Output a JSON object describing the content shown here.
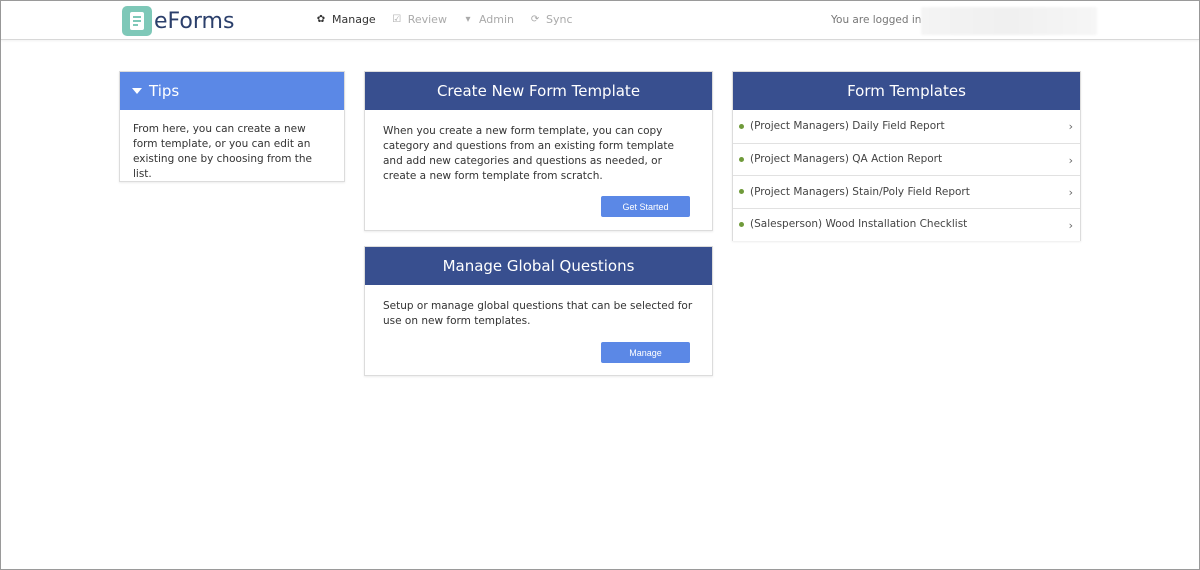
{
  "header": {
    "brand": "eForms",
    "nav": [
      {
        "label": "Manage",
        "icon": "gear-icon",
        "glyph": "✿",
        "active": true
      },
      {
        "label": "Review",
        "icon": "checkbox-icon",
        "glyph": "☑",
        "active": false
      },
      {
        "label": "Admin",
        "icon": "caret-down-icon",
        "glyph": "▾",
        "active": false
      },
      {
        "label": "Sync",
        "icon": "refresh-icon",
        "glyph": "⟳",
        "active": false
      }
    ],
    "logged_in_text": "You are logged in as"
  },
  "tips": {
    "title": "Tips",
    "body": "From here, you can create a new form template, or you can edit an existing one by choosing from the list."
  },
  "create_template": {
    "title": "Create New Form Template",
    "body": "When you create a new form template, you can copy category and questions from an existing form template and add new categories and questions as needed, or create a new form template from scratch.",
    "button": "Get Started"
  },
  "global_questions": {
    "title": "Manage Global Questions",
    "body": "Setup or manage global questions that can be selected for use on new form templates.",
    "button": "Manage"
  },
  "form_templates": {
    "title": "Form Templates",
    "items": [
      "(Project Managers) Daily Field Report",
      "(Project Managers) QA Action Report",
      "(Project Managers) Stain/Poly Field Report",
      "(Salesperson) Wood Installation Checklist"
    ]
  },
  "colors": {
    "panel_header": "#384f8f",
    "accent": "#5b88e6",
    "bullet": "#6f9a3a",
    "brand_logo": "#7ec8b8"
  }
}
